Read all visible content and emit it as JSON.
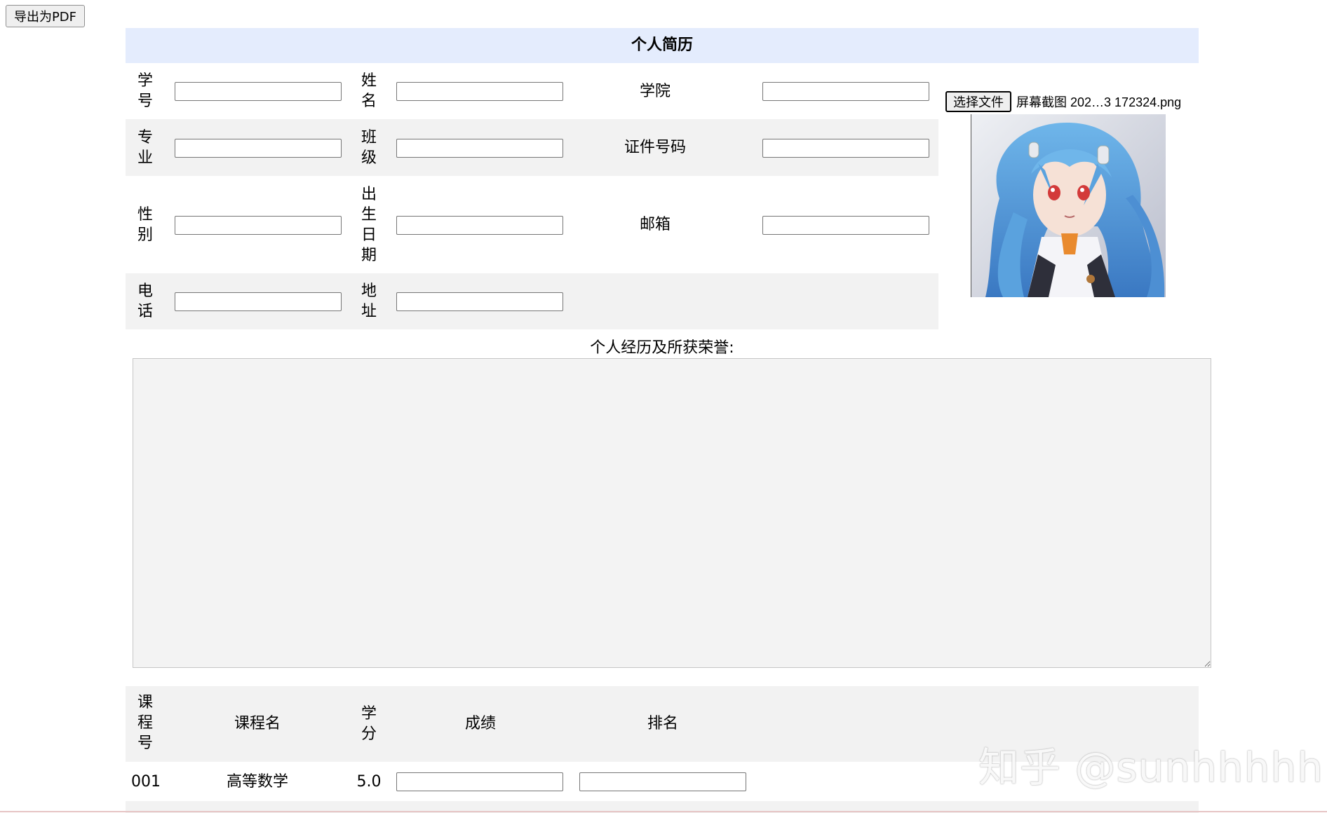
{
  "toolbar": {
    "export_label": "导出为PDF"
  },
  "resume": {
    "title": "个人简历"
  },
  "fields": {
    "student_id": "学号",
    "name": "姓名",
    "college": "学院",
    "major": "专业",
    "class": "班级",
    "id_number": "证件号码",
    "gender": "性别",
    "birth_date": "出生日期",
    "email": "邮箱",
    "phone": "电话",
    "address": "地址"
  },
  "photo": {
    "choose_label": "选择文件",
    "file_name": "屏幕截图 202…3 172324.png"
  },
  "experience": {
    "label": "个人经历及所获荣誉:"
  },
  "courses": {
    "headers": {
      "course_id": "课程号",
      "course_name": "课程名",
      "credit": "学分",
      "score": "成绩",
      "rank": "排名"
    },
    "rows": [
      {
        "course_id": "001",
        "course_name": "高等数学",
        "credit": "5.0"
      }
    ]
  },
  "watermark": "知乎 @sunhhhhh",
  "colors": {
    "title_bg": "#e4ecfd",
    "row_shade": "#f2f2f2"
  }
}
